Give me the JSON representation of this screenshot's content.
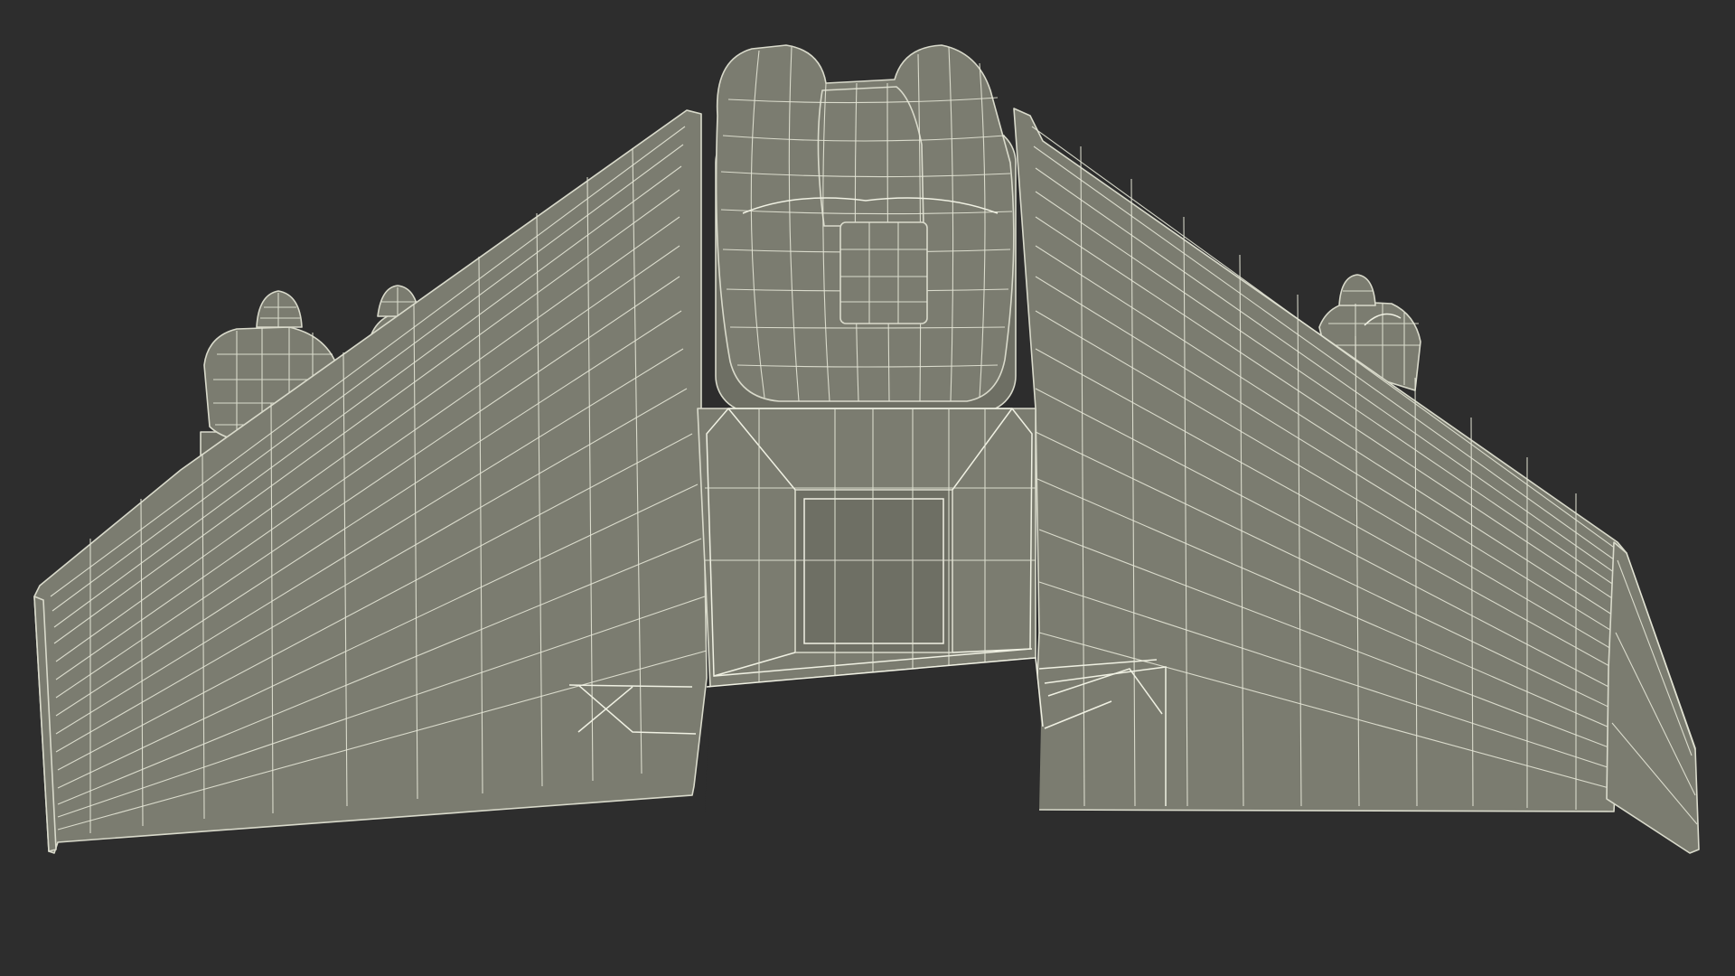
{
  "scene": {
    "background_color": "#2d2d2d",
    "surface_color": "#7b7c70",
    "wire_color": "#e4e5d6",
    "subject": "wireframe-flying-wing-jetpack-model"
  }
}
